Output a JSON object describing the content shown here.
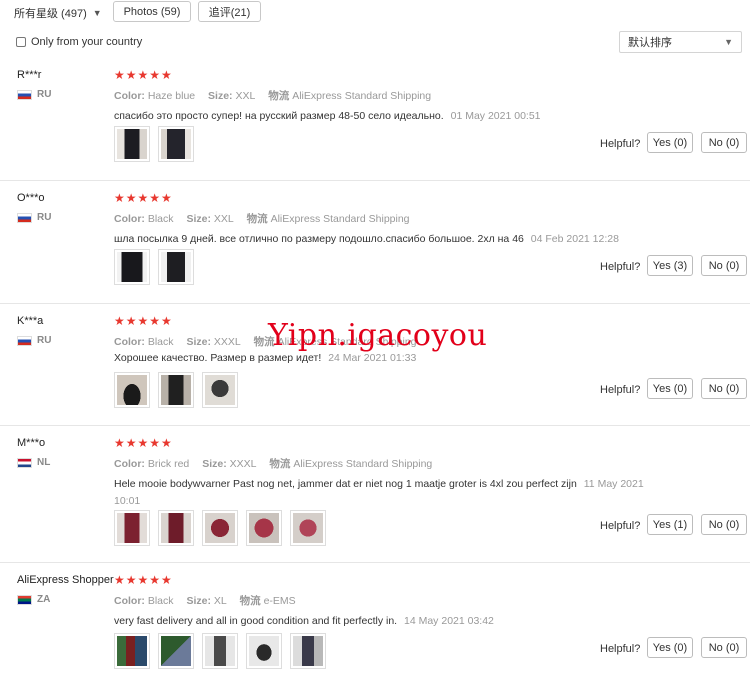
{
  "filters": {
    "rating": "所有星级 (497)",
    "photos": "Photos (59)",
    "followup": "追评(21)",
    "country_label": "Only from your country",
    "sort": "默认排序"
  },
  "labels": {
    "color": "Color:",
    "size": "Size:",
    "shipping": "物流",
    "helpful": "Helpful?"
  },
  "watermark": "Yipn.igacoyou",
  "reviews": [
    {
      "user": "R***r",
      "country": "RU",
      "stars": "★★★★★",
      "color": "Haze blue",
      "size": "XXL",
      "shipping": "AliExpress Standard Shipping",
      "text": "спасибо это просто супер! на русский размер 48-50 село идеально.",
      "date": "01 May 2021 00:51",
      "yes": "Yes (0)",
      "no": "No (0)"
    },
    {
      "user": "O***o",
      "country": "RU",
      "stars": "★★★★★",
      "color": "Black",
      "size": "XXL",
      "shipping": "AliExpress Standard Shipping",
      "text": "шла посылка 9 дней. все отлично по размеру подошло.спасибо большое. 2хл на 46",
      "date": "04 Feb 2021 12:28",
      "yes": "Yes (3)",
      "no": "No (0)"
    },
    {
      "user": "K***a",
      "country": "RU",
      "stars": "★★★★★",
      "color": "Black",
      "size": "XXXL",
      "shipping": "AliExpress Standard Shipping",
      "text": "Хорошее качество. Размер в размер идет!",
      "date": "24 Mar 2021 01:33",
      "yes": "Yes (0)",
      "no": "No (0)"
    },
    {
      "user": "M***o",
      "country": "NL",
      "stars": "★★★★★",
      "color": "Brick red",
      "size": "XXXL",
      "shipping": "AliExpress Standard Shipping",
      "text": "Hele mooie bodywvarner Past nog net, jammer dat er niet nog 1 maatje groter is 4xl zou perfect zijn",
      "date": "11 May 2021 10:01",
      "yes": "Yes (1)",
      "no": "No (0)"
    },
    {
      "user": "AliExpress Shopper",
      "country": "ZA",
      "stars": "★★★★★",
      "color": "Black",
      "size": "XL",
      "shipping": "e-EMS",
      "text": "very fast delivery and all in good condition and fit perfectly in.",
      "date": "14 May 2021 03:42",
      "yes": "Yes (0)",
      "no": "No (0)"
    }
  ]
}
